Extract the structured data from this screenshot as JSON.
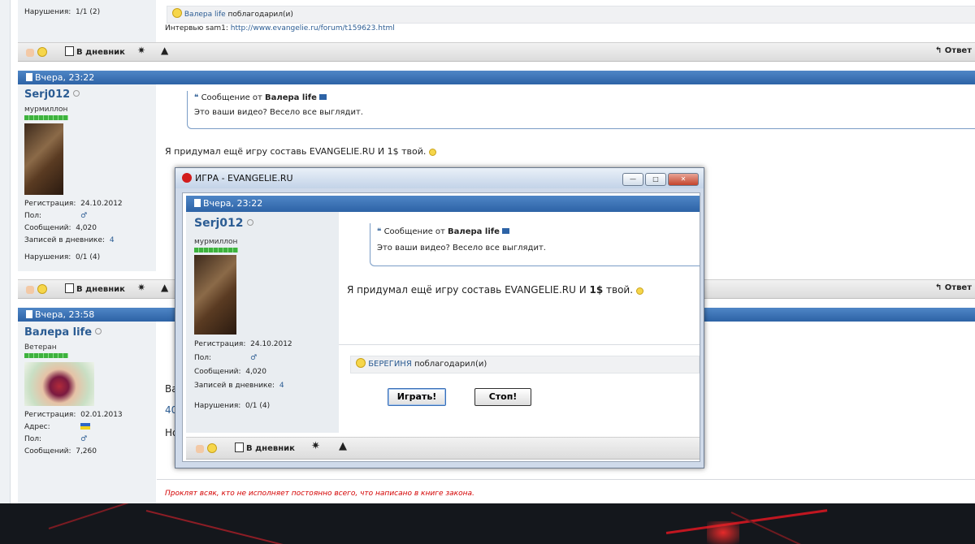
{
  "colors": {
    "accent": "#2d63a6",
    "link": "#2b5c93",
    "signature": "#d40000",
    "desktop": "#14171c"
  },
  "post_top": {
    "violations_label": "Нарушения:",
    "violations_value": "1/1 (2)",
    "thanks_user": "Валера life",
    "thanks_text": "поблагодарил(и)",
    "interview_prefix": "Интервью sam1:",
    "interview_link": "http://www.evangelie.ru/forum/t159623.html"
  },
  "toolbar": {
    "diary": "В дневник",
    "reply": "Ответ",
    "icons": [
      "hand-icon",
      "smile-icon",
      "book-icon",
      "star-icon",
      "warning-icon",
      "reply-icon"
    ]
  },
  "post_serj": {
    "date": "Вчера, 23:22",
    "username": "Serj012",
    "rank": "мурмиллон",
    "reg_label": "Регистрация:",
    "reg_value": "24.10.2012",
    "gender_label": "Пол:",
    "gender_value": "♂",
    "messages_label": "Сообщений:",
    "messages_value": "4,020",
    "diary_label": "Записей в дневнике:",
    "diary_value": "4",
    "violations_label": "Нарушения:",
    "violations_value": "0/1 (4)",
    "quote_prefix": "Сообщение от",
    "quote_author": "Валера life",
    "quote_text": "Это ваши видео? Весело все выглядит.",
    "body": "Я придумал ещё игру составь EVANGELIE.RU И 1$ твой."
  },
  "post_valera": {
    "date": "Вчера, 23:58",
    "username": "Валера life",
    "rank": "Ветеран",
    "reg_label": "Регистрация:",
    "reg_value": "02.01.2013",
    "address_label": "Адрес:",
    "gender_label": "Пол:",
    "gender_value": "♂",
    "messages_label": "Сообщений:",
    "messages_value": "7,260",
    "partial_lines": [
      "Ва",
      "40",
      "Но"
    ],
    "signature": "Проклят всяк, кто не исполняет постоянно всего, что написано в книге закона."
  },
  "dialog": {
    "title": "ИГРА - EVANGELIE.RU",
    "window_buttons": {
      "minimize": "—",
      "maximize": "□",
      "close": "✕"
    },
    "date": "Вчера, 23:22",
    "username": "Serj012",
    "rank": "мурмиллон",
    "reg_label": "Регистрация:",
    "reg_value": "24.10.2012",
    "gender_label": "Пол:",
    "gender_value": "♂",
    "messages_label": "Сообщений:",
    "messages_value": "4,020",
    "diary_label": "Записей в дневнике:",
    "diary_value": "4",
    "violations_label": "Нарушения:",
    "violations_value": "0/1 (4)",
    "quote_prefix": "Сообщение от",
    "quote_author": "Валера life",
    "quote_text": "Это ваши видео? Весело все выглядит.",
    "body_start": "Я придумал ещё игру составь EVANGELIE.RU И ",
    "body_bold": "1$",
    "body_end": " твой.",
    "thanks_user": "БЕРЕГИНЯ",
    "thanks_text": "поблагодарил(и)",
    "play_button": "Играть!",
    "stop_button": "Стоп!",
    "diary": "В дневник"
  }
}
